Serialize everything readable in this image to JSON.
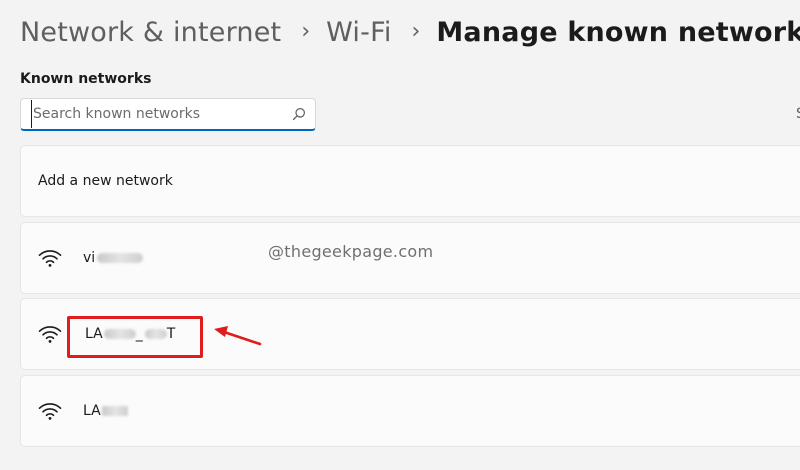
{
  "breadcrumb": {
    "items": [
      "Network & internet",
      "Wi-Fi"
    ],
    "current": "Manage known networks",
    "separator": "›"
  },
  "section": {
    "label": "Known networks"
  },
  "search": {
    "placeholder": "Search known networks",
    "icon": "search-icon"
  },
  "right_edge_text": "S",
  "add_network": {
    "label": "Add a new network"
  },
  "networks": [
    {
      "name": "vi",
      "icon": "wifi-icon"
    },
    {
      "name_start": "LA",
      "name_mid": "_",
      "name_end": "T",
      "icon": "wifi-icon"
    },
    {
      "name": "LA",
      "icon": "wifi-icon"
    }
  ],
  "watermark": "@thegeekpage.com",
  "annotation": {
    "color": "#e01c1c"
  },
  "colors": {
    "accent": "#0067c0",
    "background": "#f3f3f3",
    "card": "#fbfbfb"
  }
}
